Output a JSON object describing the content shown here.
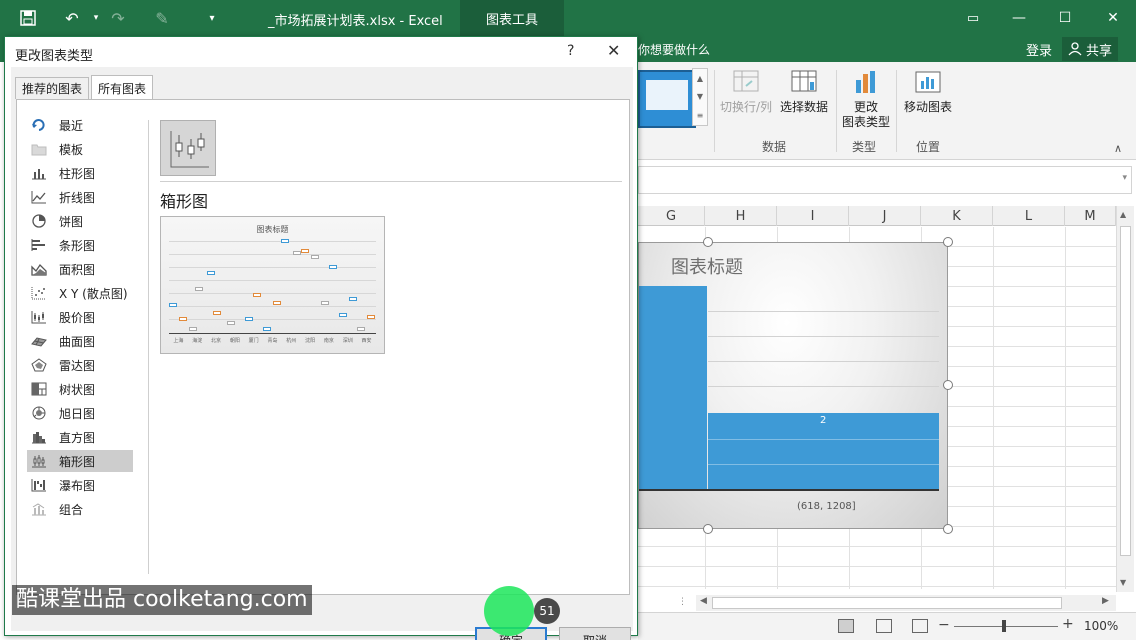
{
  "window": {
    "doc_title": "_市场拓展计划表.xlsx - Excel",
    "context_tab": "图表工具",
    "tell_me": "你想要做什么",
    "login": "登录",
    "share": "共享"
  },
  "ribbon": {
    "switch_row_col": "切换行/列",
    "select_data": "选择数据",
    "change_type_line1": "更改",
    "change_type_line2": "图表类型",
    "move_chart": "移动图表",
    "group_data": "数据",
    "group_type": "类型",
    "group_location": "位置"
  },
  "sheet": {
    "columns": [
      "G",
      "H",
      "I",
      "J",
      "K",
      "L",
      "M"
    ],
    "chart": {
      "title": "图表标题",
      "bar_label": "2",
      "category_label": "(618, 1208]"
    },
    "zoom": "100%"
  },
  "dialog": {
    "title": "更改图表类型",
    "help": "?",
    "tabs": [
      "推荐的图表",
      "所有图表"
    ],
    "categories": [
      "最近",
      "模板",
      "柱形图",
      "折线图",
      "饼图",
      "条形图",
      "面积图",
      "X Y (散点图)",
      "股价图",
      "曲面图",
      "雷达图",
      "树状图",
      "旭日图",
      "直方图",
      "箱形图",
      "瀑布图",
      "组合"
    ],
    "selected_type": "箱形图",
    "preview": {
      "title": "图表标题",
      "categories": [
        "上海",
        "海淀",
        "北京",
        "朝阳",
        "厦门",
        "青岛",
        "杭州",
        "沈阳",
        "南京",
        "深圳",
        "西安"
      ]
    },
    "ok": "确定",
    "cancel": "取消"
  },
  "overlay": {
    "watermark": "酷课堂出品 coolketang.com",
    "step": "51"
  },
  "colors": {
    "excel_green": "#217346",
    "chart_bar": "#3e9ad6",
    "selection_gray": "#cdcdcd"
  }
}
